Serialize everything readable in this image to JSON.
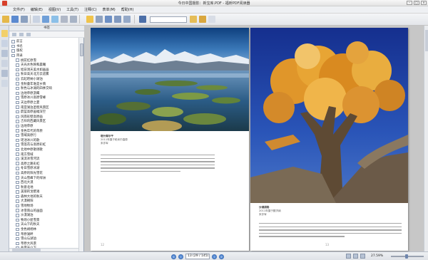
{
  "window": {
    "title": "今日中国摄影：新宝库.PDF - 福昕PDF阅读器"
  },
  "menubar": {
    "items": [
      "文件(F)",
      "编辑(E)",
      "视图(V)",
      "工具(T)",
      "注释(C)",
      "表单(M)",
      "帮助(H)"
    ]
  },
  "toolbar": {
    "search_placeholder": ""
  },
  "sidebar": {
    "panel_title": "书签",
    "bookmarks": [
      {
        "label": "前言",
        "level": 0
      },
      {
        "label": "书名",
        "level": 0
      },
      {
        "label": "版权",
        "level": 0
      },
      {
        "label": "目录",
        "level": 0
      },
      {
        "label": "桃花红原雪",
        "level": 1
      },
      {
        "label": "天光水色映和晨曦",
        "level": 1
      },
      {
        "label": "旭日洞天美水如画画",
        "level": 1
      },
      {
        "label": "秋日高天北方云遮雾",
        "level": 1
      },
      {
        "label": "云起哈纳小湖泊",
        "level": 1
      },
      {
        "label": "金秋童年谁是乡情",
        "level": 1
      },
      {
        "label": "秋色与冰湖的四季交响",
        "level": 1
      },
      {
        "label": "边地草原游鹰",
        "level": 1
      },
      {
        "label": "雪原冰川高原雪峰",
        "level": 1
      },
      {
        "label": "天边草原之夏",
        "level": 1
      },
      {
        "label": "南亚湖泊圣壁风景区",
        "level": 1
      },
      {
        "label": "蔚蓝高原画幅深空",
        "level": 1
      },
      {
        "label": "风雨彩壁高原画",
        "level": 1
      },
      {
        "label": "吉祥的西藏风景区",
        "level": 1
      },
      {
        "label": "边地草原",
        "level": 1
      },
      {
        "label": "金色年代的草原",
        "level": 1
      },
      {
        "label": "雪域高原行",
        "level": 1
      },
      {
        "label": "瑶池冰川的歌",
        "level": 1
      },
      {
        "label": "雪莲花与高原彩虹",
        "level": 1
      },
      {
        "label": "北地中原歌颂歌",
        "level": 1
      },
      {
        "label": "南方雪域",
        "level": 1
      },
      {
        "label": "溪流冰雪河流",
        "level": 1
      },
      {
        "label": "高原之路彩虹",
        "level": 1
      },
      {
        "label": "冬日雪原冰湖",
        "level": 1
      },
      {
        "label": "高原的阳光雪花",
        "level": 1
      },
      {
        "label": "天山雪峰下的绿洲",
        "level": 1
      },
      {
        "label": "西北大漠",
        "level": 1
      },
      {
        "label": "秋意北地",
        "level": 1
      },
      {
        "label": "美丽的戈壁滩",
        "level": 1
      },
      {
        "label": "森林大地的秋天",
        "level": 1
      },
      {
        "label": "大漠朝阳",
        "level": 1
      },
      {
        "label": "雪地牧场",
        "level": 1
      },
      {
        "label": "冰雪南山的画面",
        "level": 1
      },
      {
        "label": "沙漠湖泊",
        "level": 1
      },
      {
        "label": "牧场小屋雪景",
        "level": 1
      },
      {
        "label": "天山下的秋天",
        "level": 1
      },
      {
        "label": "金色胡杨林",
        "level": 1
      },
      {
        "label": "草原湖畔",
        "level": 1
      },
      {
        "label": "雪山与湖泊",
        "level": 1
      },
      {
        "label": "草原大风景",
        "level": 1
      },
      {
        "label": "冬雪天山下",
        "level": 1
      },
      {
        "label": "西部高原",
        "level": 1
      }
    ]
  },
  "page_left": {
    "caption_title": "塔什库尔干",
    "caption_line1": "2011年摄于帕米尔高原",
    "caption_line2": "宋亦军",
    "page_number": "12"
  },
  "page_right": {
    "caption_title": "沙漠胡杨",
    "caption_line1": "2011年摄于额济纳",
    "caption_line2": "宋亦军",
    "page_number": "13"
  },
  "statusbar": {
    "page_indicator": "13 (29 / 145)",
    "zoom": "27.59%"
  }
}
